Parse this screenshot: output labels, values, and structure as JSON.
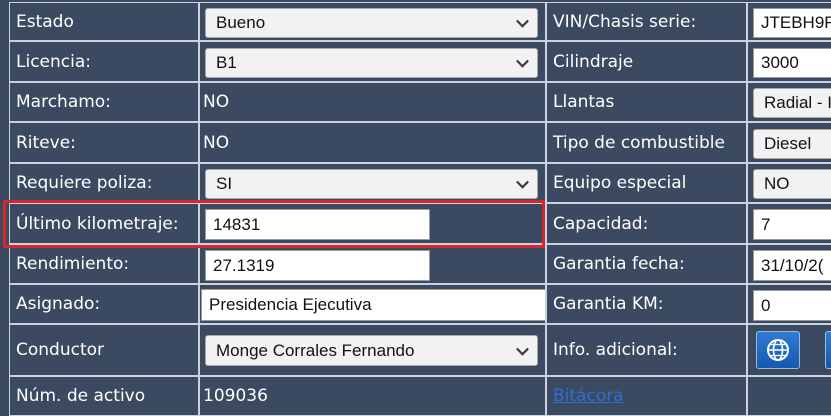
{
  "rows_left": [
    {
      "label": "Estado",
      "value": "Bueno",
      "kind": "select"
    },
    {
      "label": "Licencia:",
      "value": "B1",
      "kind": "select"
    },
    {
      "label": "Marchamo:",
      "value": "NO",
      "kind": "text"
    },
    {
      "label": "Riteve:",
      "value": "NO",
      "kind": "text"
    },
    {
      "label": "Requiere poliza:",
      "value": "SI",
      "kind": "select"
    },
    {
      "label": "Último kilometraje:",
      "value": "14831",
      "kind": "input"
    },
    {
      "label": "Rendimiento:",
      "value": "27.1319",
      "kind": "input"
    },
    {
      "label": "Asignado:",
      "value": "Presidencia Ejecutiva",
      "kind": "input"
    },
    {
      "label": "Conductor",
      "value": "Monge Corrales Fernando",
      "kind": "select"
    },
    {
      "label": "Núm. de activo",
      "value": "109036",
      "kind": "text"
    }
  ],
  "rows_right": [
    {
      "label": "VIN/Chasis serie:",
      "value": "JTEBH9F"
    },
    {
      "label": "Cilindraje",
      "value": "3000"
    },
    {
      "label": "Llantas",
      "value": "Radial - I"
    },
    {
      "label": "Tipo de combustible",
      "value": "Diesel"
    },
    {
      "label": "Equipo especial",
      "value": "NO"
    },
    {
      "label": "Capacidad:",
      "value": "7"
    },
    {
      "label": "Garantia fecha:",
      "value": "31/10/2("
    },
    {
      "label": "Garantia KM:",
      "value": "0"
    },
    {
      "label": "Info. adicional:",
      "value": ""
    },
    {
      "label": "Bitácora",
      "value": ""
    }
  ],
  "icons": {
    "info_button": "globe-icon"
  },
  "colors": {
    "background": "#3b4a60",
    "highlight": "#d9262a",
    "link": "#2f6fd0"
  }
}
